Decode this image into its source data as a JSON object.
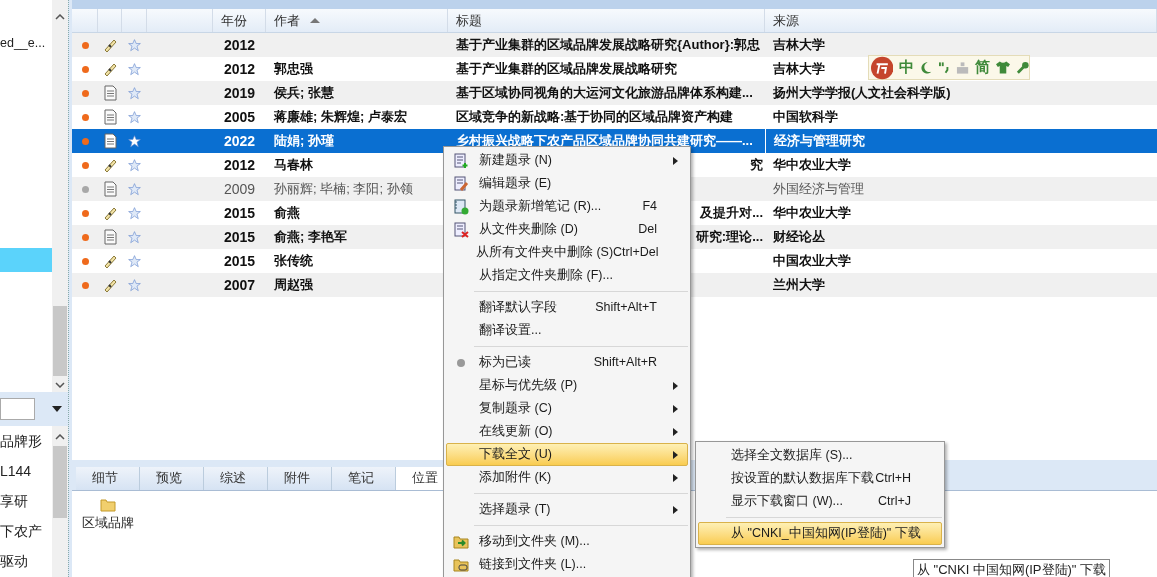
{
  "sidebar": {
    "top_item": "ed__e...",
    "list_items": [
      "品牌形",
      "L144",
      "享研",
      "下农产",
      "驱动"
    ]
  },
  "table": {
    "columns": [
      {
        "sorted": false
      },
      {
        "sorted": false
      },
      {
        "sorted": false
      },
      {
        "sorted": false
      },
      {
        "label": "年份",
        "sorted": false
      },
      {
        "label": "作者",
        "sorted": true
      },
      {
        "label": "标题",
        "sorted": false
      },
      {
        "label": "来源",
        "sorted": false
      }
    ],
    "rows": [
      {
        "kind": "thesis",
        "read": false,
        "selected": false,
        "year": "2012",
        "title": "基于产业集群的区域品牌发展战略研究{Author}:郭忠",
        "source": "吉林大学"
      },
      {
        "kind": "thesis",
        "read": false,
        "selected": false,
        "year": "2012",
        "author": "郭忠强",
        "title": "基于产业集群的区域品牌发展战略研究",
        "source": "吉林大学"
      },
      {
        "kind": "article",
        "read": false,
        "selected": false,
        "year": "2019",
        "author": "侯兵; 张慧",
        "title": "基于区域协同视角的大运河文化旅游品牌体系构建...",
        "source": "扬州大学学报(人文社会科学版)"
      },
      {
        "kind": "article",
        "read": false,
        "selected": false,
        "year": "2005",
        "author": "蒋廉雄; 朱辉煌; 卢泰宏",
        "title": "区域竞争的新战略:基于协同的区域品牌资产构建",
        "source": "中国软科学"
      },
      {
        "kind": "article",
        "read": false,
        "selected": true,
        "year": "2022",
        "author": "陆娟; 孙瑾",
        "title": "乡村振兴战略下农产品区域品牌协同共建研究——...",
        "source": "经济与管理研究"
      },
      {
        "kind": "thesis",
        "read": false,
        "selected": false,
        "year": "2012",
        "author": "马春林",
        "title": "究",
        "source": "华中农业大学"
      },
      {
        "kind": "article",
        "read": true,
        "selected": false,
        "year": "2009",
        "author": "孙丽辉; 毕楠; 李阳; 孙领",
        "source": "外国经济与管理"
      },
      {
        "kind": "thesis",
        "read": false,
        "selected": false,
        "year": "2015",
        "author": "俞燕",
        "title": "及提升对...",
        "source": "华中农业大学"
      },
      {
        "kind": "article",
        "read": false,
        "selected": false,
        "year": "2015",
        "author": "俞燕; 李艳军",
        "title": "研究:理论...",
        "source": "财经论丛"
      },
      {
        "kind": "thesis",
        "read": false,
        "selected": false,
        "year": "2015",
        "author": "张传统",
        "source": "中国农业大学"
      },
      {
        "kind": "thesis",
        "read": false,
        "selected": false,
        "year": "2007",
        "author": "周赵强",
        "source": "兰州大学"
      }
    ]
  },
  "detail_tabs": [
    {
      "label": "细节",
      "selected": false
    },
    {
      "label": "预览",
      "selected": false
    },
    {
      "label": "综述",
      "selected": false
    },
    {
      "label": "附件",
      "selected": false
    },
    {
      "label": "笔记",
      "selected": false
    },
    {
      "label": "位置",
      "selected": true
    }
  ],
  "location_folder": "区域品牌",
  "ime_toolbar": {
    "mode": "中",
    "script": "简"
  },
  "context_menu": [
    {
      "kind": "item",
      "label": "新建题录 (N)",
      "submenu": true,
      "selected": false
    },
    {
      "kind": "item",
      "label": "编辑题录 (E)",
      "submenu": false,
      "selected": false
    },
    {
      "kind": "item",
      "label": "为题录新增笔记 (R)...",
      "shortcut": "F4",
      "submenu": false,
      "selected": false
    },
    {
      "kind": "item",
      "label": "从文件夹删除 (D)",
      "shortcut": "Del",
      "submenu": false,
      "selected": false
    },
    {
      "kind": "item",
      "label": "从所有文件夹中删除 (S)",
      "shortcut": "Ctrl+Del",
      "submenu": false,
      "selected": false
    },
    {
      "kind": "item",
      "label": "从指定文件夹删除 (F)...",
      "submenu": false,
      "selected": false
    },
    {
      "kind": "separator"
    },
    {
      "kind": "item",
      "label": "翻译默认字段",
      "shortcut": "Shift+Alt+T",
      "submenu": false,
      "selected": false
    },
    {
      "kind": "item",
      "label": "翻译设置...",
      "submenu": false,
      "selected": false
    },
    {
      "kind": "separator"
    },
    {
      "kind": "item",
      "label": "标为已读",
      "shortcut": "Shift+Alt+R",
      "submenu": false,
      "selected": false
    },
    {
      "kind": "item",
      "label": "星标与优先级 (P)",
      "submenu": true,
      "selected": false
    },
    {
      "kind": "item",
      "label": "复制题录 (C)",
      "submenu": true,
      "selected": false
    },
    {
      "kind": "item",
      "label": "在线更新 (O)",
      "submenu": true,
      "selected": false
    },
    {
      "kind": "item",
      "label": "下载全文 (U)",
      "submenu": true,
      "selected": true
    },
    {
      "kind": "item",
      "label": "添加附件 (K)",
      "submenu": true,
      "selected": false
    },
    {
      "kind": "separator"
    },
    {
      "kind": "item",
      "label": "选择题录 (T)",
      "submenu": true,
      "selected": false
    },
    {
      "kind": "separator"
    },
    {
      "kind": "item",
      "label": "移动到文件夹 (M)...",
      "submenu": false,
      "selected": false
    },
    {
      "kind": "item",
      "label": "链接到文件夹 (L)...",
      "submenu": false,
      "selected": false
    }
  ],
  "submenu": [
    {
      "kind": "item",
      "label": "选择全文数据库 (S)...",
      "selected": false
    },
    {
      "kind": "item",
      "label": "按设置的默认数据库下载",
      "shortcut": "Ctrl+H",
      "selected": false
    },
    {
      "kind": "item",
      "label": "显示下载窗口 (W)...",
      "shortcut": "Ctrl+J",
      "selected": false
    },
    {
      "kind": "separator"
    },
    {
      "kind": "item",
      "label": "从 \"CNKI_中国知网(IP登陆)\" 下载",
      "selected": true
    }
  ],
  "tooltip": "从 \"CNKI 中国知网(IP登陆)\" 下载"
}
